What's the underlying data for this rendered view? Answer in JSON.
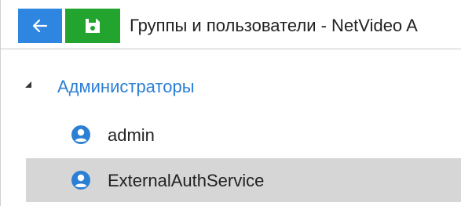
{
  "window": {
    "title": "Группы и пользователи - NetVideo A"
  },
  "toolbar": {
    "back_icon": "arrow-left-icon",
    "save_icon": "floppy-disk-icon"
  },
  "tree": {
    "group": {
      "label": "Администраторы",
      "icon": "collapse-triangle-icon"
    },
    "users": [
      {
        "label": "admin",
        "icon": "user-circle-icon"
      },
      {
        "label": "ExternalAuthService",
        "icon": "user-circle-icon"
      }
    ]
  },
  "colors": {
    "back_button": "#2f86e0",
    "save_button": "#22a42f",
    "group_text": "#2b7fd4",
    "user_icon": "#2b7fd4",
    "selected_row": "#d6d6d6"
  }
}
